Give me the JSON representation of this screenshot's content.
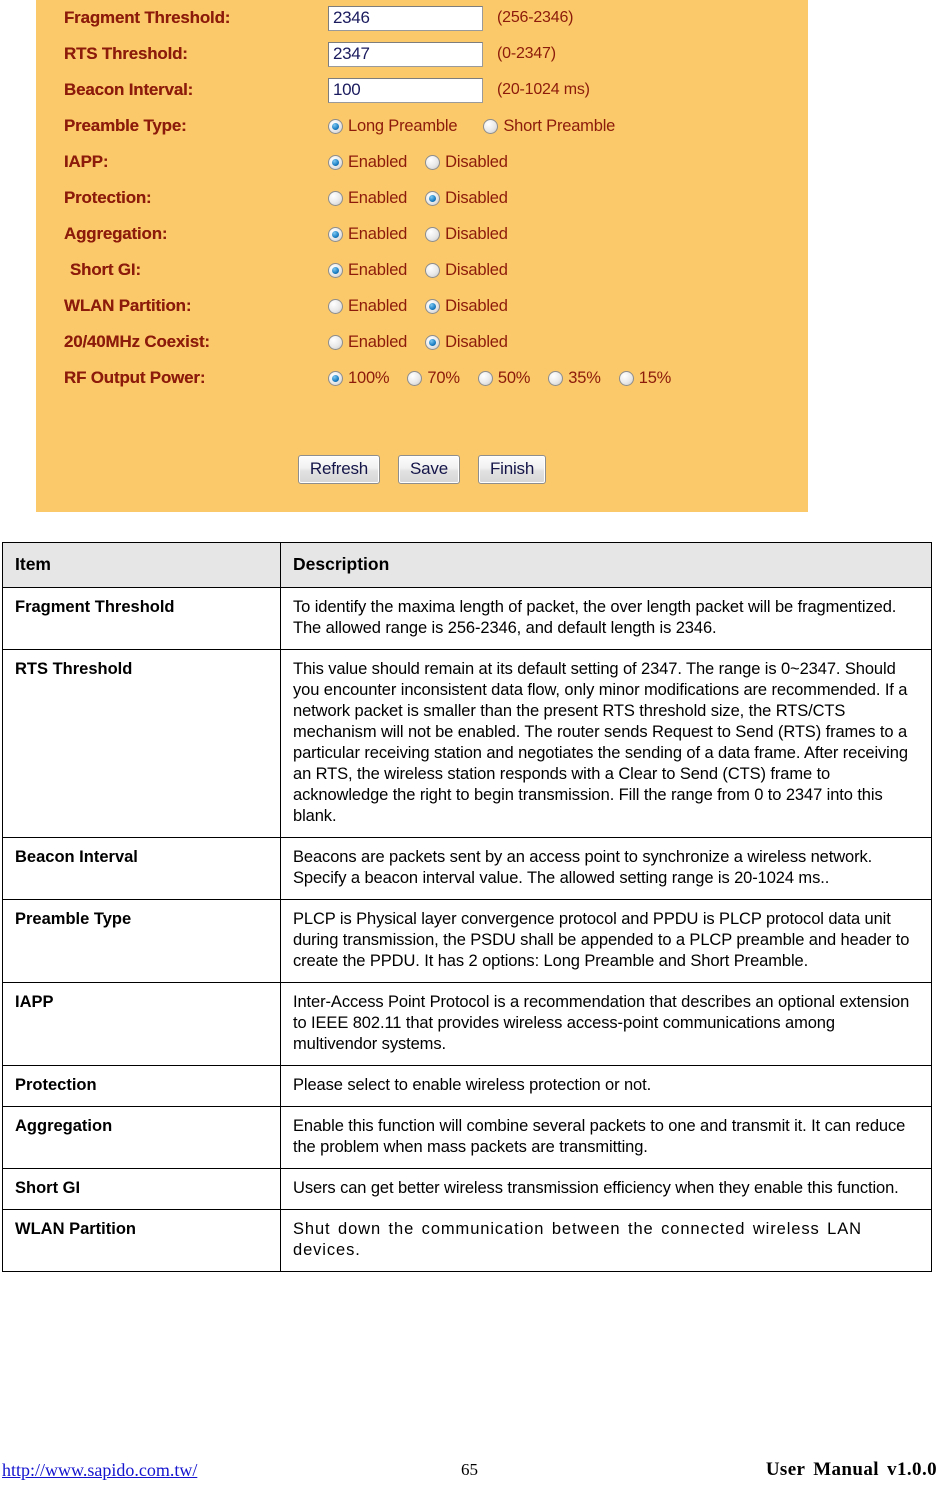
{
  "panel": {
    "background_color": "#fbc969",
    "label_color": "#8c1b0b",
    "fields": [
      {
        "label": "Fragment Threshold:",
        "type": "text",
        "value": "2346",
        "hint": "(256-2346)"
      },
      {
        "label": "RTS Threshold:",
        "type": "text",
        "value": "2347",
        "hint": "(0-2347)"
      },
      {
        "label": "Beacon Interval:",
        "type": "text",
        "value": "100",
        "hint": "(20-1024 ms)"
      },
      {
        "label": "Preamble Type:",
        "type": "radio",
        "options": [
          {
            "label": "Long Preamble",
            "checked": true
          },
          {
            "label": "Short Preamble",
            "checked": false
          }
        ]
      },
      {
        "label": "IAPP:",
        "type": "radio",
        "options": [
          {
            "label": "Enabled",
            "checked": true
          },
          {
            "label": "Disabled",
            "checked": false
          }
        ]
      },
      {
        "label": "Protection:",
        "type": "radio",
        "options": [
          {
            "label": "Enabled",
            "checked": false
          },
          {
            "label": "Disabled",
            "checked": true
          }
        ]
      },
      {
        "label": "Aggregation:",
        "type": "radio",
        "options": [
          {
            "label": "Enabled",
            "checked": true
          },
          {
            "label": "Disabled",
            "checked": false
          }
        ]
      },
      {
        "label": "Short GI:",
        "type": "radio",
        "options": [
          {
            "label": "Enabled",
            "checked": true
          },
          {
            "label": "Disabled",
            "checked": false
          }
        ]
      },
      {
        "label": "WLAN Partition:",
        "type": "radio",
        "options": [
          {
            "label": "Enabled",
            "checked": false
          },
          {
            "label": "Disabled",
            "checked": true
          }
        ]
      },
      {
        "label": "20/40MHz Coexist:",
        "type": "radio",
        "options": [
          {
            "label": "Enabled",
            "checked": false
          },
          {
            "label": "Disabled",
            "checked": true
          }
        ]
      },
      {
        "label": "RF Output Power:",
        "type": "radio",
        "options": [
          {
            "label": "100%",
            "checked": true
          },
          {
            "label": "70%",
            "checked": false
          },
          {
            "label": "50%",
            "checked": false
          },
          {
            "label": "35%",
            "checked": false
          },
          {
            "label": "15%",
            "checked": false
          }
        ]
      }
    ],
    "buttons": [
      {
        "label": "Refresh"
      },
      {
        "label": "Save"
      },
      {
        "label": "Finish"
      }
    ]
  },
  "table": {
    "headers": [
      "Item",
      "Description"
    ],
    "rows": [
      {
        "item": "Fragment Threshold",
        "description": "To identify the maxima length of packet, the over length packet will be fragmentized. The allowed range is 256-2346, and default length is 2346."
      },
      {
        "item": "RTS Threshold",
        "description": "This value should remain at its default setting of 2347. The range is 0~2347. Should you encounter inconsistent data flow, only minor modifications are recommended. If a network packet is smaller than the present RTS threshold size, the RTS/CTS mechanism will not be enabled. The router sends Request to Send (RTS) frames to a particular receiving station and negotiates the sending of a data frame. After receiving an RTS, the wireless station responds with a Clear to Send (CTS) frame to acknowledge the right to begin transmission. Fill the range from 0 to 2347 into this blank."
      },
      {
        "item": "Beacon Interval",
        "description": "Beacons are packets sent by an access point to synchronize a wireless network. Specify a beacon interval value. The allowed setting range is 20-1024 ms.."
      },
      {
        "item": "Preamble Type",
        "description": "PLCP is Physical layer convergence protocol and PPDU is PLCP protocol data unit during transmission, the PSDU shall be appended to a PLCP preamble and header to create the PPDU. It has 2 options: Long Preamble and Short Preamble."
      },
      {
        "item": "IAPP",
        "description": "Inter-Access Point Protocol is a recommendation that describes an optional extension to IEEE 802.11 that provides wireless access-point communications among multivendor systems."
      },
      {
        "item": "Protection",
        "description": "Please select to enable wireless protection or not."
      },
      {
        "item": "Aggregation",
        "description": "Enable this function will combine several packets to one and transmit it. It can reduce the problem when mass packets are transmitting."
      },
      {
        "item": "Short GI",
        "description": "Users can get better wireless transmission efficiency when they enable this function."
      },
      {
        "item": "WLAN Partition",
        "description": "Shut down the communication between the connected wireless LAN devices.",
        "style": "spaced"
      }
    ]
  },
  "footer": {
    "url": "http://www.sapido.com.tw/",
    "page_number": "65",
    "manual": "User Manual v1.0.0"
  }
}
